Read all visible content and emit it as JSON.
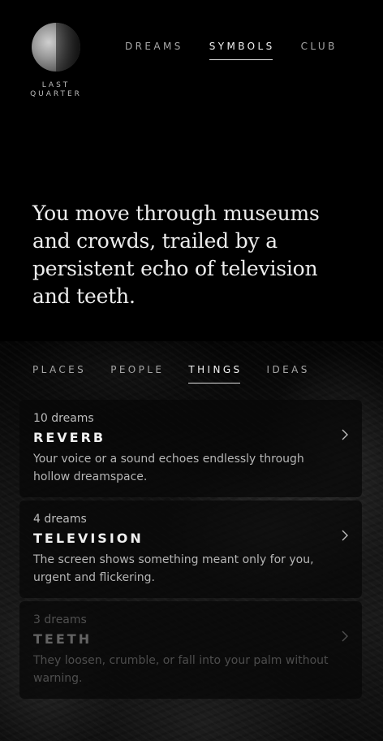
{
  "moon": {
    "phase_label": "LAST\nQUARTER"
  },
  "nav": {
    "items": [
      {
        "label": "DREAMS",
        "active": false
      },
      {
        "label": "SYMBOLS",
        "active": true
      },
      {
        "label": "CLUB",
        "active": false
      }
    ]
  },
  "hero": {
    "text": "You move through museums and crowds, trailed by a persistent echo of television and teeth."
  },
  "tabs": {
    "items": [
      {
        "label": "PLACES",
        "active": false
      },
      {
        "label": "PEOPLE",
        "active": false
      },
      {
        "label": "THINGS",
        "active": true
      },
      {
        "label": "IDEAS",
        "active": false
      }
    ]
  },
  "cards": [
    {
      "count": "10 dreams",
      "title": "REVERB",
      "description": "Your voice or a sound echoes endlessly through hollow dreamspace."
    },
    {
      "count": "4 dreams",
      "title": "TELEVISION",
      "description": "The screen shows something meant only for you, urgent and flickering."
    },
    {
      "count": "3 dreams",
      "title": "TEETH",
      "description": "They loosen, crumble, or fall into your palm without warning."
    }
  ],
  "icons": {
    "moon": "moon-last-quarter-icon",
    "chevron": "chevron-right-icon"
  },
  "colors": {
    "background": "#000000",
    "text_primary": "#f0f0f0",
    "text_secondary": "#bdbdbd"
  }
}
